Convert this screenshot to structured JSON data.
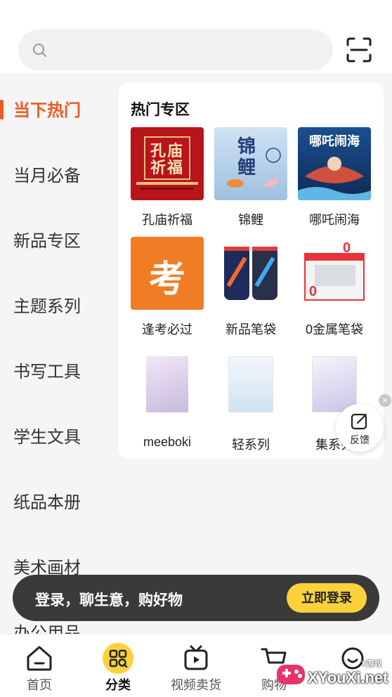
{
  "search": {
    "placeholder": ""
  },
  "sidebar": {
    "items": [
      {
        "label": "当下热门",
        "active": true
      },
      {
        "label": "当月必备"
      },
      {
        "label": "新品专区"
      },
      {
        "label": "主题系列"
      },
      {
        "label": "书写工具"
      },
      {
        "label": "学生文具"
      },
      {
        "label": "纸品本册"
      },
      {
        "label": "美术画材"
      },
      {
        "label": "办公用品"
      }
    ]
  },
  "section": {
    "title": "热门专区",
    "items": [
      {
        "label": "孔庙祈福",
        "thumb_text": "孔庙祈福",
        "color": "#b8141c"
      },
      {
        "label": "锦鲤",
        "thumb_text": "锦鲤",
        "color": "#a9c8e6"
      },
      {
        "label": "哪吒闹海",
        "thumb_text": "哪吒闹海",
        "color": "#1b3e73"
      },
      {
        "label": "逢考必过",
        "thumb_text": "考",
        "color": "#f07d26"
      },
      {
        "label": "新品笔袋",
        "color": "#1e2b5c"
      },
      {
        "label": "0金属笔袋",
        "color": "#e8333a"
      },
      {
        "label": "meeboki",
        "color": "#d8c9e8"
      },
      {
        "label": "轻系列",
        "color": "#d6e7f2"
      },
      {
        "label": "集系列",
        "color": "#d9d5ea"
      }
    ]
  },
  "feedback": {
    "label": "反馈"
  },
  "login": {
    "text": "登录，聊生意，购好物",
    "button": "立即登录"
  },
  "tabbar": {
    "items": [
      {
        "label": "首页"
      },
      {
        "label": "分类",
        "active": true
      },
      {
        "label": "视频卖货"
      },
      {
        "label": "购物"
      },
      {
        "label": ""
      }
    ]
  },
  "watermark": {
    "text": "XYouXi.net",
    "small": "X游戏"
  },
  "colors": {
    "accent": "#f05a23",
    "button": "#fcd13c",
    "bar": "#3a3a3a"
  }
}
